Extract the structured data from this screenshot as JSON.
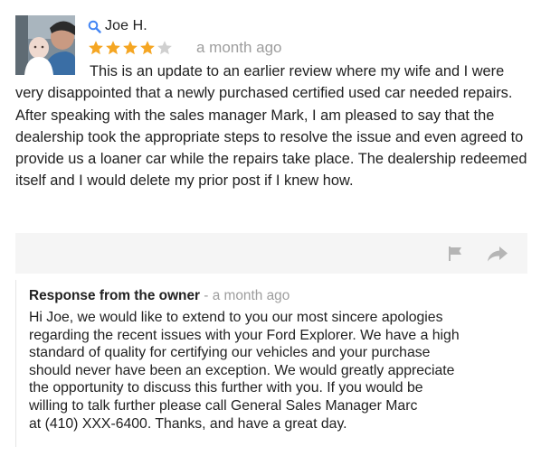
{
  "review": {
    "reviewer_name": "Joe H.",
    "rating": 4,
    "rating_max": 5,
    "date": "a month ago",
    "text": "This is an update to an earlier review where my wife and I were very disappointed that a newly purchased certified used car needed repairs. After speaking with the sales manager Mark, I am pleased to say that the dealership took the appropriate steps to resolve the issue and even agreed to provide us a loaner car while the repairs take place. The dealership redeemed itself and I would delete my prior post if I knew how."
  },
  "actions": {
    "flag_icon": "flag-icon",
    "share_icon": "share-icon"
  },
  "owner_response": {
    "label": "Response from the owner",
    "separator": " - ",
    "date": "a month ago",
    "lines": [
      "Hi Joe, we would like to extend to you our most sincere apologies",
      "regarding the recent issues with your Ford Explorer. We have a high",
      "standard of quality for certifying our vehicles and your purchase",
      "should never have been an exception. We would greatly appreciate",
      "the opportunity to discuss this further with you. If you would be",
      "willing to talk further please call General Sales Manager Marc",
      "at (410) XXX-6400. Thanks, and have a great day."
    ]
  },
  "colors": {
    "star_filled": "#f5a623",
    "star_empty": "#d0d0d0",
    "link_blue": "#4285f4",
    "muted_text": "#9e9e9e",
    "action_bar": "#f5f5f5",
    "icon_gray": "#b5b5b5"
  }
}
